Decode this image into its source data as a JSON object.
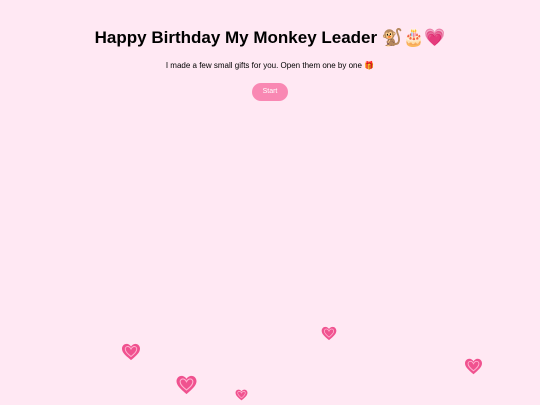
{
  "header": {
    "title": "Happy Birthday My Monkey Leader 🐒🎂💗",
    "subtitle": "I made a few small gifts for you. Open them one by one 🎁"
  },
  "start_button": {
    "label": "Start"
  },
  "decorations": {
    "heart_icon": "heart-icon",
    "heart_color": "#f0528f",
    "heart_highlight": "#ffb3d1"
  },
  "colors": {
    "background": "#ffe8f3",
    "accent": "#f988b3"
  }
}
